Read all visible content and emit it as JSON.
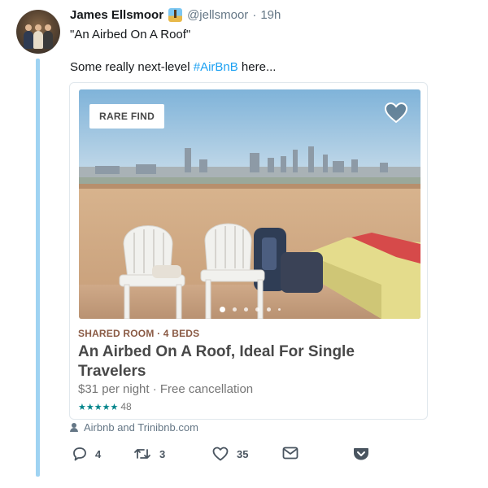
{
  "tweet": {
    "author_name": "James Ellsmoor",
    "handle": "@jellsmoor",
    "separator": "·",
    "time": "19h",
    "line1": "\"An Airbed On A Roof\"",
    "line2_prefix": "Some really next-level ",
    "hashtag": "#AirBnB",
    "line2_suffix": " here..."
  },
  "card": {
    "badge": "RARE FIND",
    "room_type": "SHARED ROOM · 4 BEDS",
    "title": "An Airbed On A Roof, Ideal For Single Travelers",
    "price_text": "$31 per night · Free cancellation",
    "stars": "★★★★★",
    "rating_count": "48",
    "photo_pager": {
      "total": 6,
      "active_index": 0
    }
  },
  "source": "Airbnb and Trinibnb.com",
  "actions": {
    "reply_count": "4",
    "retweet_count": "3",
    "like_count": "35"
  },
  "colors": {
    "hashtag": "#1da1f2",
    "thread_line": "#9fd3f2",
    "room_type": "#8a5a44",
    "stars": "#00848a",
    "icon_gray": "#657786"
  }
}
